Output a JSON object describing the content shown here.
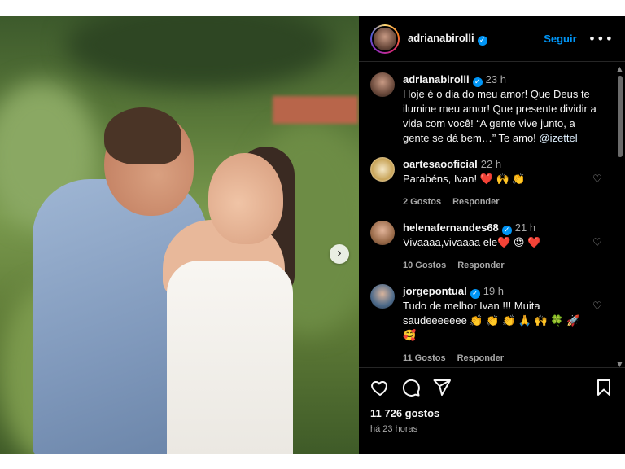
{
  "post": {
    "author": "adrianabirolli",
    "follow_label": "Seguir",
    "more_label": "•••",
    "likes": "11 726 gostos",
    "posted_ago": "há 23 horas"
  },
  "caption": {
    "name": "adrianabirolli",
    "time": "23 h",
    "text": "Hoje é o dia do meu amor! Que Deus te ilumine meu amor! Que presente dividir a vida com você! “A gente vive junto, a gente se dá bem…” Te amo! ",
    "mention": "@izettel"
  },
  "comments": [
    {
      "name": "oartesaooficial",
      "verified": false,
      "time": "22 h",
      "text": "Parabéns, Ivan! ❤️ 🙌 👏",
      "likes": "2 Gostos",
      "reply": "Responder"
    },
    {
      "name": "helenafernandes68",
      "verified": true,
      "time": "21 h",
      "text": "Vivaaaa,vivaaaa ele❤️ 😍 ❤️",
      "likes": "10 Gostos",
      "reply": "Responder"
    },
    {
      "name": "jorgepontual",
      "verified": true,
      "time": "19 h",
      "text": "Tudo de melhor Ivan !!! Muita saudeeeeeee 👏 👏 👏 🙏 🙌 🍀 🚀 🥰",
      "likes": "11 Gostos",
      "reply": "Responder"
    }
  ],
  "icons": {
    "next": "chevron-right-icon",
    "like": "heart-icon",
    "comment": "comment-icon",
    "share": "send-icon",
    "save": "bookmark-icon",
    "verified": "verified-badge-icon"
  },
  "colors": {
    "accent": "#0095f6",
    "background": "#000000",
    "muted": "#a8a8a8"
  }
}
